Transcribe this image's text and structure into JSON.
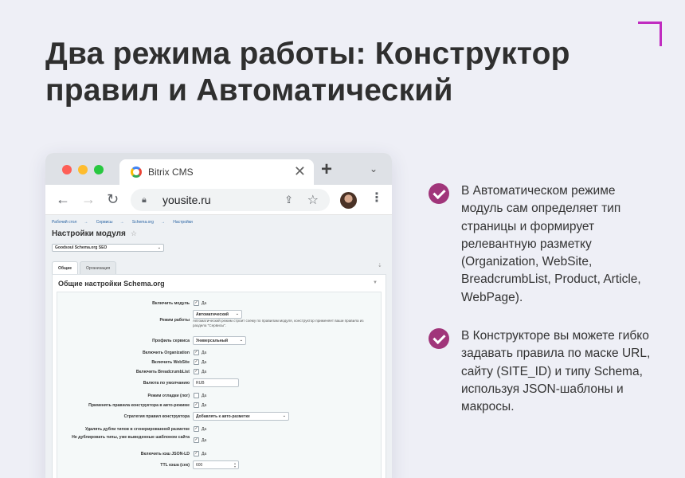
{
  "headline": "Два режима работы: Конструктор правил и Автоматический",
  "browser": {
    "tab_title": "Bitrix CMS",
    "tab_close": "✕",
    "new_tab": "+",
    "tab_menu": "⌄",
    "url": "yousite.ru"
  },
  "bitrix": {
    "breadcrumbs": [
      "Рабочий стол",
      "Сервисы",
      "Schema.org",
      "Настройки"
    ],
    "breadcrumb_sep": "→",
    "page_title": "Настройки модуля",
    "site_select": "Goodsoul Schema.org SEO",
    "tabs": [
      "Общие",
      "Организация"
    ],
    "panel_title": "Общие настройки Schema.org",
    "check_mark": "✓",
    "yes": "Да",
    "fields": {
      "enable_module": "Включить модуль",
      "mode": "Режим работы",
      "mode_value": "Автоматический",
      "mode_hint": "Автоматический режим строит схему по правилам модуля, конструктор применяет ваши правила из раздела \"Сервисы\".",
      "profile": "Профиль сервиса",
      "profile_value": "Универсальный",
      "enable_org": "Включить Organization",
      "enable_website": "Включить WebSite",
      "enable_breadcrumbs": "Включить BreadcrumbList",
      "currency": "Валюта по умолчанию",
      "currency_value": "RUB",
      "debug": "Режим отладки (лог)",
      "apply_rules": "Применять правила конструктора в авто-режиме",
      "strategy": "Стратегия правил конструктора",
      "strategy_value": "Добавлять к авто-разметке",
      "remove_dupes": "Удалять дубли типов в сгенерированной разметке",
      "no_dup": "Не дублировать типы, уже выведенные шаблоном сайта",
      "cache": "Включить кэш JSON-LD",
      "ttl": "TTL кэша (сек)",
      "ttl_value": "600"
    }
  },
  "bullets": [
    "В Автоматическом режиме модуль сам определяет тип страницы и формирует релевантную разметку (Organization, WebSite, BreadcrumbList, Product, Article, WebPage).",
    "В Конструкторе вы можете гибко задавать правила по маске URL, сайту (SITE_ID) и типу Schema, используя JSON-шаблоны и макросы."
  ],
  "colors": {
    "accent": "#c02cc0",
    "check": "#a0357a",
    "background": "#eeeff6"
  }
}
